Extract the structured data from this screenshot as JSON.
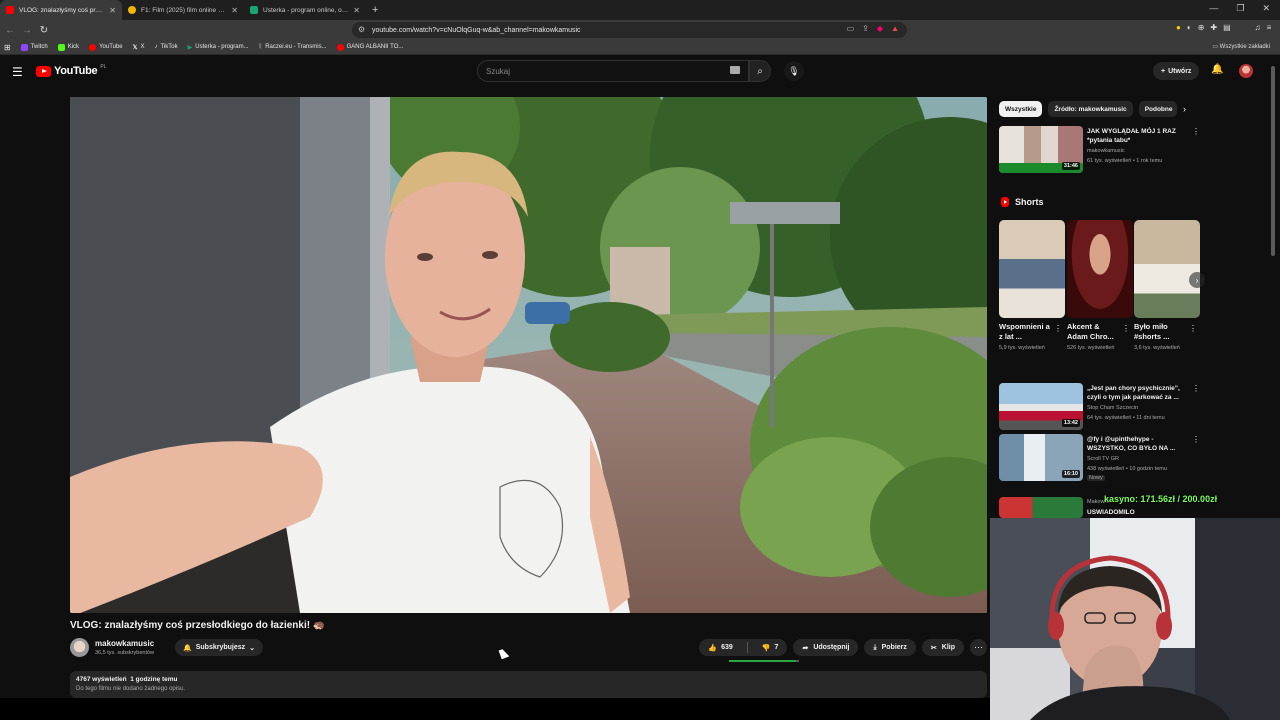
{
  "browser": {
    "tabs": [
      {
        "title": "VLOG: znalazłyśmy coś przes...",
        "active": true,
        "color": "#ff0000"
      },
      {
        "title": "F1: Film (2025) film online - Gdzie ob...",
        "active": false,
        "color": "#f2b705"
      },
      {
        "title": "Usterka - program online, oglądaj na ...",
        "active": false,
        "color": "#17a673"
      }
    ],
    "new_tab": "+",
    "url": "youtube.com/watch?v=cNuOlqGuq-w&ab_channel=makowkamusic",
    "bookmarks": [
      {
        "label": "Twitch",
        "color": "#9146ff"
      },
      {
        "label": "Kick",
        "color": "#53fc18"
      },
      {
        "label": "YouTube",
        "color": "#ff0000"
      },
      {
        "label": "X",
        "color": "#ffffff"
      },
      {
        "label": "TikTok",
        "color": "#25f4ee"
      },
      {
        "label": "Usterka - program...",
        "color": "#17a673"
      },
      {
        "label": "Raczei.eu - Transmis...",
        "color": "#dddddd"
      },
      {
        "label": "GANG ALBANII TO...",
        "color": "#ff0000"
      }
    ],
    "all_bookmarks": "Wszystkie zakładki"
  },
  "header": {
    "logo": "YouTube",
    "country": "PL",
    "search_placeholder": "Szukaj",
    "create_label": "Utwórz"
  },
  "video": {
    "title": "VLOG: znalazłyśmy coś przesłodkiego do łazienki! 🦔",
    "channel": "makowkamusic",
    "subscribers": "36,5 tys. subskrybentów",
    "subscribe_label": "Subskrybujesz",
    "likes": "639",
    "dislikes": "7",
    "like_ratio": 0.95,
    "share_label": "Udostępnij",
    "download_label": "Pobierz",
    "clip_label": "Klip",
    "views": "4767 wyświetleń",
    "age": "1 godzinę temu",
    "description": "Do tego filmu nie dodano żadnego opisu."
  },
  "sidebar": {
    "chips": [
      "Wszystkie",
      "Źródło: makowkamusic",
      "Podobne"
    ],
    "recs": [
      {
        "title": "JAK WYGLĄDAŁ MÓJ 1 RAZ *pytania tabu*",
        "channel": "makowkamusic",
        "meta": "61 tys. wyświetleń • 1 rok temu",
        "duration": "31:46"
      },
      {
        "title": "„Jest pan chory psychicznie”, czyli o tym jak parkować za ...",
        "channel": "Stop Cham Szczecin",
        "meta": "64 tys. wyświetleń • 11 dni temu",
        "duration": "13:42"
      },
      {
        "title": "@fy i @upinthehype - WSZYSTKO, CO BYŁO NA ...",
        "channel": "Scroll TV GR",
        "meta": "438 wyświetleń • 10 godzin temu",
        "badge": "Nowy",
        "duration": "16:10"
      },
      {
        "title": "USWIADOMILO",
        "channel": "Makowka",
        "meta": "",
        "duration": ""
      }
    ],
    "shorts_heading": "Shorts",
    "shorts": [
      {
        "title": "Wspomnieni a z lat ...",
        "views": "5,9 tys. wyświetleń"
      },
      {
        "title": "Akcent & Adam Chro...",
        "views": "526 tys. wyświetleń"
      },
      {
        "title": "Było miło #shorts ...",
        "views": "3,6 tys. wyświetleń"
      }
    ]
  },
  "overlay": {
    "goal": "kasyno: 171.56zł / 200.00zł"
  }
}
